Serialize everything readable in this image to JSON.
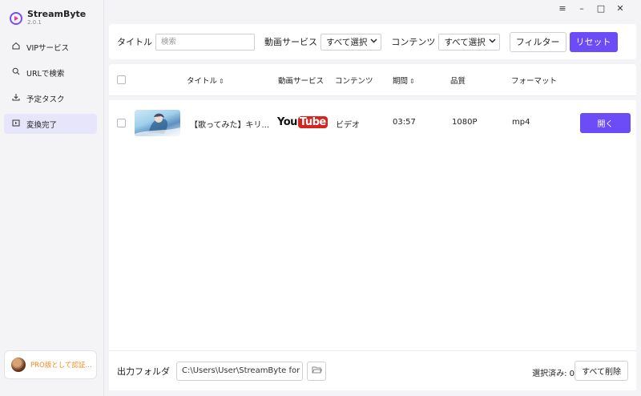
{
  "app": {
    "name": "StreamByte",
    "version": "2.0.1"
  },
  "window_controls": {
    "menu": "≡",
    "minimize": "–",
    "maximize": "□",
    "close": "✕"
  },
  "sidebar": {
    "items": [
      {
        "label": "VIPサービス",
        "icon": "home-icon"
      },
      {
        "label": "URLで検索",
        "icon": "search-icon"
      },
      {
        "label": "予定タスク",
        "icon": "download-icon"
      },
      {
        "label": "変換完了",
        "icon": "converted-icon",
        "active": true
      }
    ],
    "pro_label": "PRO版として認証..."
  },
  "filter": {
    "title_label": "タイトル",
    "search_placeholder": "検索",
    "service_label": "動画サービス",
    "service_value": "すべて選択",
    "content_label": "コンテンツ",
    "content_value": "すべて選択",
    "filter_button": "フィルター",
    "reset_button": "リセット"
  },
  "table": {
    "headers": [
      "タイトル",
      "動画サービス",
      "コンテンツ",
      "期間",
      "品質",
      "フォーマット"
    ],
    "rows": [
      {
        "title": "【歌ってみた】キリ...",
        "service_logo_you": "You",
        "service_logo_tube": "Tube",
        "content": "ビデオ",
        "duration": "03:57",
        "quality": "1080P",
        "format": "mp4",
        "action": "開く"
      }
    ]
  },
  "footer": {
    "output_label": "出力フォルダ",
    "output_path": "C:\\Users\\User\\StreamByte for",
    "selected_label": "選択済み: 0",
    "delete_all": "すべて削除"
  },
  "colors": {
    "accent": "#6b4cf6",
    "pro": "#f08a1e",
    "youtube_red": "#d3261e"
  }
}
